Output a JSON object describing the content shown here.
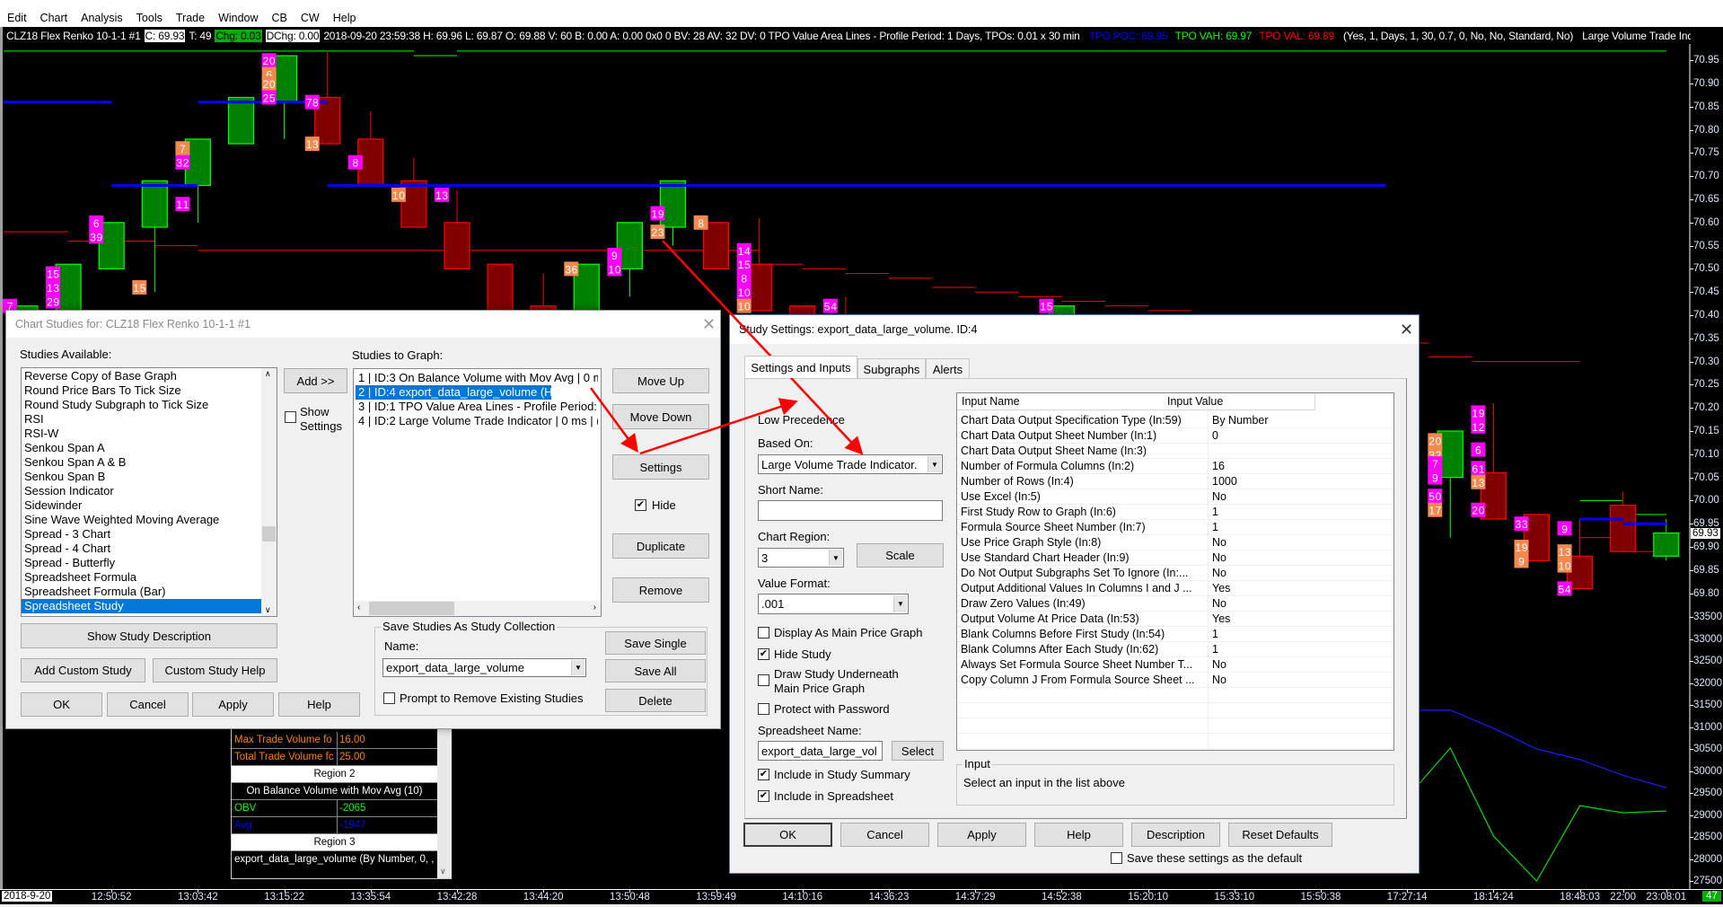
{
  "menu": [
    "Edit",
    "Chart",
    "Analysis",
    "Tools",
    "Trade",
    "Window",
    "CB",
    "CW",
    "Help"
  ],
  "status_bar": {
    "symbol": "CLZ18  Flex Renko 10-1-1  #1",
    "close": "C: 69.93",
    "ticks": "T: 49",
    "chg": "Chg: 0.03",
    "dchg": "DChg: 0.00",
    "details": "2018-09-20 23:59:38 H: 69.96 L: 69.87 O: 69.88 V: 60 B: 0.00 A: 0.00 0x0 0 BV: 28 AV: 32 DV: 0 TPO Value Area Lines - Profile Period: 1 Days, TPOs: 0.01 x 30 min",
    "poc": "TPO POC: 69.95",
    "vah": "TPO VAH: 69.97",
    "val": "TPO VAL: 69.89",
    "params": "(Yes, 1, Days, 1, 30, 0.7, 0, No, No, Standard, No)",
    "next_study": "Large Volume Trade Indicator   (6, M",
    "colors": {
      "poc": "#0000ff",
      "vah": "#00ff00",
      "val": "#ff0000",
      "chg_bg": "#00b000"
    }
  },
  "price_chart": {
    "type": "renko-candlestick",
    "price_axis": [
      "70.95",
      "70.90",
      "70.85",
      "70.80",
      "70.75",
      "70.70",
      "70.65",
      "70.60",
      "70.55",
      "70.50",
      "70.45",
      "70.40",
      "70.35",
      "70.30",
      "70.25",
      "70.20",
      "70.15",
      "70.10",
      "70.05",
      "70.00",
      "69.95",
      "69.90",
      "69.85",
      "69.80"
    ],
    "volume_axis": [
      "33500",
      "33000",
      "32500",
      "32000",
      "31500",
      "31000",
      "30500",
      "30000",
      "29500",
      "29000",
      "28500",
      "28000",
      "27500"
    ],
    "current_price": "69.93",
    "date_label": "2018-9-20",
    "bar_count": "47",
    "time_labels": [
      {
        "bar": 2,
        "t": "12:50:52"
      },
      {
        "bar": 4,
        "t": "13:03:42"
      },
      {
        "bar": 6,
        "t": "13:15:22"
      },
      {
        "bar": 8,
        "t": "13:35:54"
      },
      {
        "bar": 10,
        "t": "13:42:28"
      },
      {
        "bar": 12,
        "t": "13:44:20"
      },
      {
        "bar": 14,
        "t": "13:50:48"
      },
      {
        "bar": 16,
        "t": "13:59:49"
      },
      {
        "bar": 18,
        "t": "14:10:16"
      },
      {
        "bar": 20,
        "t": "14:36:23"
      },
      {
        "bar": 22,
        "t": "14:37:29"
      },
      {
        "bar": 24,
        "t": "14:52:38"
      },
      {
        "bar": 26,
        "t": "15:20:10"
      },
      {
        "bar": 28,
        "t": "15:33:10"
      },
      {
        "bar": 30,
        "t": "15:50:38"
      },
      {
        "bar": 32,
        "t": "17:27:14"
      },
      {
        "bar": 34,
        "t": "18:14:24"
      },
      {
        "bar": 36,
        "t": "18:48:03"
      },
      {
        "bar": 37,
        "t": "22:00"
      },
      {
        "bar": 38,
        "t": "23:08:01"
      }
    ],
    "candles": [
      {
        "bar": 0,
        "o": 70.32,
        "c": 70.42,
        "h": 70.42,
        "l": 70.32
      },
      {
        "bar": 1,
        "o": 70.41,
        "c": 70.51,
        "h": 70.51,
        "l": 70.41
      },
      {
        "bar": 2,
        "o": 70.5,
        "c": 70.6,
        "h": 70.6,
        "l": 70.5
      },
      {
        "bar": 3,
        "o": 70.59,
        "c": 70.69,
        "h": 70.69,
        "l": 70.45
      },
      {
        "bar": 4,
        "o": 70.68,
        "c": 70.78,
        "h": 70.78,
        "l": 70.6
      },
      {
        "bar": 5,
        "o": 70.77,
        "c": 70.87,
        "h": 70.87,
        "l": 70.77
      },
      {
        "bar": 6,
        "o": 70.86,
        "c": 70.96,
        "h": 70.96,
        "l": 70.78
      },
      {
        "bar": 7,
        "o": 70.87,
        "c": 70.77,
        "h": 70.97,
        "l": 70.77
      },
      {
        "bar": 8,
        "o": 70.78,
        "c": 70.68,
        "h": 70.84,
        "l": 70.68
      },
      {
        "bar": 9,
        "o": 70.69,
        "c": 70.59,
        "h": 70.74,
        "l": 70.59
      },
      {
        "bar": 10,
        "o": 70.6,
        "c": 70.5,
        "h": 70.67,
        "l": 70.5
      },
      {
        "bar": 11,
        "o": 70.51,
        "c": 70.41,
        "h": 70.51,
        "l": 70.41
      },
      {
        "bar": 12,
        "o": 70.42,
        "c": 70.32,
        "h": 70.49,
        "l": 70.32
      },
      {
        "bar": 13,
        "o": 70.41,
        "c": 70.51,
        "h": 70.51,
        "l": 70.41
      },
      {
        "bar": 14,
        "o": 70.5,
        "c": 70.6,
        "h": 70.6,
        "l": 70.44
      },
      {
        "bar": 15,
        "o": 70.59,
        "c": 70.69,
        "h": 70.69,
        "l": 70.55
      },
      {
        "bar": 16,
        "o": 70.6,
        "c": 70.5,
        "h": 70.6,
        "l": 70.5
      },
      {
        "bar": 17,
        "o": 70.51,
        "c": 70.41,
        "h": 70.61,
        "l": 70.41
      },
      {
        "bar": 18,
        "o": 70.42,
        "c": 70.32,
        "h": 70.42,
        "l": 70.32
      },
      {
        "bar": 19,
        "o": 70.32,
        "c": 70.22,
        "h": 70.44,
        "l": 70.22
      },
      {
        "bar": 24,
        "o": 70.32,
        "c": 70.42,
        "h": 70.42,
        "l": 70.32
      },
      {
        "bar": 33,
        "o": 70.05,
        "c": 70.15,
        "h": 70.15,
        "l": 69.92
      },
      {
        "bar": 34,
        "o": 70.06,
        "c": 69.96,
        "h": 70.21,
        "l": 69.96
      },
      {
        "bar": 35,
        "o": 69.97,
        "c": 69.87,
        "h": 69.97,
        "l": 69.87
      },
      {
        "bar": 36,
        "o": 69.88,
        "c": 69.81,
        "h": 69.96,
        "l": 69.81
      },
      {
        "bar": 37,
        "o": 69.99,
        "c": 69.89,
        "h": 70.02,
        "l": 69.89
      },
      {
        "bar": 38,
        "o": 69.88,
        "c": 69.93,
        "h": 69.96,
        "l": 69.87
      }
    ],
    "vah_lines": [
      {
        "from": 0,
        "to": 9.5,
        "p": 70.97
      },
      {
        "from": 9.5,
        "to": 10.5,
        "p": 70.96
      },
      {
        "from": 10.5,
        "to": 38.5,
        "p": 70.97
      },
      {
        "from": 36.5,
        "to": 37.5,
        "p": 70.0
      },
      {
        "from": 37.5,
        "to": 38.5,
        "p": 69.97
      }
    ],
    "poc_lines": [
      {
        "from": 0,
        "to": 2.5,
        "p": 70.86
      },
      {
        "from": 2.5,
        "to": 4.5,
        "p": 70.68
      },
      {
        "from": 4.5,
        "to": 7.5,
        "p": 70.86
      },
      {
        "from": 7.5,
        "to": 32,
        "p": 70.68
      },
      {
        "from": 36.5,
        "to": 37.5,
        "p": 69.96
      },
      {
        "from": 37.5,
        "to": 38.5,
        "p": 69.95
      }
    ],
    "val_lines": [
      {
        "from": 0,
        "to": 1.5,
        "p": 70.58
      },
      {
        "from": 1.5,
        "to": 3.5,
        "p": 70.56
      },
      {
        "from": 3.5,
        "to": 4.5,
        "p": 70.55
      },
      {
        "from": 4.5,
        "to": 6.5,
        "p": 70.54
      },
      {
        "from": 6.5,
        "to": 13.5,
        "p": 70.54
      },
      {
        "from": 13.5,
        "to": 17.5,
        "p": 70.54
      },
      {
        "from": 17.5,
        "to": 18.5,
        "p": 70.51
      },
      {
        "from": 18.5,
        "to": 19.5,
        "p": 70.5
      },
      {
        "from": 19.5,
        "to": 20.5,
        "p": 70.49
      },
      {
        "from": 20.5,
        "to": 21.5,
        "p": 70.48
      },
      {
        "from": 21.5,
        "to": 22.5,
        "p": 70.46
      },
      {
        "from": 22.5,
        "to": 23.5,
        "p": 70.45
      },
      {
        "from": 23.5,
        "to": 24.5,
        "p": 70.44
      },
      {
        "from": 24.5,
        "to": 25.5,
        "p": 70.43
      },
      {
        "from": 25.5,
        "to": 26.5,
        "p": 70.42
      },
      {
        "from": 26.5,
        "to": 27.5,
        "p": 70.41
      },
      {
        "from": 32,
        "to": 33,
        "p": 70.34
      },
      {
        "from": 33,
        "to": 34,
        "p": 70.31
      },
      {
        "from": 34,
        "to": 36.5,
        "p": 70.3
      },
      {
        "from": 36.5,
        "to": 37.5,
        "p": 69.92
      },
      {
        "from": 37.5,
        "to": 38.5,
        "p": 69.89
      }
    ],
    "trade_labels": [
      {
        "bar": 0,
        "p": 70.42,
        "t": "7",
        "c": "m"
      },
      {
        "bar": 1,
        "p": 70.49,
        "t": "15",
        "c": "m"
      },
      {
        "bar": 1,
        "p": 70.46,
        "t": "13",
        "c": "m"
      },
      {
        "bar": 1,
        "p": 70.43,
        "t": "29",
        "c": "m"
      },
      {
        "bar": 2,
        "p": 70.6,
        "t": "6",
        "c": "m"
      },
      {
        "bar": 2,
        "p": 70.57,
        "t": "39",
        "c": "m"
      },
      {
        "bar": 3,
        "p": 70.46,
        "t": "15",
        "c": "o"
      },
      {
        "bar": 4,
        "p": 70.76,
        "t": "7",
        "c": "o"
      },
      {
        "bar": 4,
        "p": 70.73,
        "t": "32",
        "c": "m"
      },
      {
        "bar": 4,
        "p": 70.64,
        "t": "11",
        "c": "m"
      },
      {
        "bar": 6,
        "p": 70.95,
        "t": "20",
        "c": "m"
      },
      {
        "bar": 6,
        "p": 70.92,
        "t": "6",
        "c": "o"
      },
      {
        "bar": 6,
        "p": 70.9,
        "t": "20",
        "c": "o"
      },
      {
        "bar": 6,
        "p": 70.87,
        "t": "25",
        "c": "m"
      },
      {
        "bar": 7,
        "p": 70.86,
        "t": "78",
        "c": "m"
      },
      {
        "bar": 7,
        "p": 70.77,
        "t": "13",
        "c": "o"
      },
      {
        "bar": 8,
        "p": 70.73,
        "t": "8",
        "c": "m"
      },
      {
        "bar": 9,
        "p": 70.66,
        "t": "10",
        "c": "o"
      },
      {
        "bar": 10,
        "p": 70.66,
        "t": "13",
        "c": "m"
      },
      {
        "bar": 13,
        "p": 70.5,
        "t": "36",
        "c": "o"
      },
      {
        "bar": 14,
        "p": 70.53,
        "t": "9",
        "c": "m"
      },
      {
        "bar": 14,
        "p": 70.5,
        "t": "10",
        "c": "m"
      },
      {
        "bar": 15,
        "p": 70.62,
        "t": "19",
        "c": "m"
      },
      {
        "bar": 15,
        "p": 70.58,
        "t": "23",
        "c": "o"
      },
      {
        "bar": 16,
        "p": 70.6,
        "t": "8",
        "c": "o"
      },
      {
        "bar": 17,
        "p": 70.54,
        "t": "14",
        "c": "m"
      },
      {
        "bar": 17,
        "p": 70.51,
        "t": "15",
        "c": "m"
      },
      {
        "bar": 17,
        "p": 70.48,
        "t": "8",
        "c": "m"
      },
      {
        "bar": 17,
        "p": 70.45,
        "t": "10",
        "c": "m"
      },
      {
        "bar": 17,
        "p": 70.42,
        "t": "10",
        "c": "o"
      },
      {
        "bar": 19,
        "p": 70.42,
        "t": "54",
        "c": "m"
      },
      {
        "bar": 24,
        "p": 70.42,
        "t": "15",
        "c": "m"
      },
      {
        "bar": 33,
        "p": 70.13,
        "t": "20",
        "c": "o"
      },
      {
        "bar": 33,
        "p": 70.1,
        "t": "32",
        "c": "o"
      },
      {
        "bar": 33,
        "p": 70.08,
        "t": "7",
        "c": "m"
      },
      {
        "bar": 33,
        "p": 70.05,
        "t": "9",
        "c": "m"
      },
      {
        "bar": 33,
        "p": 70.01,
        "t": "50",
        "c": "m"
      },
      {
        "bar": 33,
        "p": 69.98,
        "t": "17",
        "c": "o"
      },
      {
        "bar": 34,
        "p": 70.19,
        "t": "19",
        "c": "m"
      },
      {
        "bar": 34,
        "p": 70.16,
        "t": "12",
        "c": "m"
      },
      {
        "bar": 34,
        "p": 70.11,
        "t": "6",
        "c": "m"
      },
      {
        "bar": 34,
        "p": 70.07,
        "t": "61",
        "c": "m"
      },
      {
        "bar": 34,
        "p": 70.04,
        "t": "13",
        "c": "o"
      },
      {
        "bar": 34,
        "p": 69.98,
        "t": "20",
        "c": "m"
      },
      {
        "bar": 35,
        "p": 69.95,
        "t": "33",
        "c": "m"
      },
      {
        "bar": 35,
        "p": 69.9,
        "t": "19",
        "c": "o"
      },
      {
        "bar": 35,
        "p": 69.87,
        "t": "9",
        "c": "o"
      },
      {
        "bar": 36,
        "p": 69.94,
        "t": "9",
        "c": "m"
      },
      {
        "bar": 36,
        "p": 69.89,
        "t": "13",
        "c": "o"
      },
      {
        "bar": 36,
        "p": 69.86,
        "t": "10",
        "c": "o"
      },
      {
        "bar": 36,
        "p": 69.81,
        "t": "54",
        "c": "m"
      }
    ],
    "obv": {
      "bars": [
        32,
        33,
        34,
        35,
        36,
        37,
        38
      ],
      "obv": [
        29400,
        30520,
        28520,
        27500,
        29210,
        29050,
        29090
      ],
      "avg": [
        31380,
        31380,
        30970,
        30500,
        30260,
        29900,
        29620
      ]
    },
    "colors": {
      "up_fill": "#008000",
      "up_line": "#00ff00",
      "down_fill": "#800000",
      "down_line": "#ff0000",
      "vah": "#00ff00",
      "poc": "#0000ff",
      "val": "#ff0000",
      "label_m": "#ff00ff",
      "label_o": "#f28a50",
      "obv": "#00e000",
      "avg": "#1a1aff"
    }
  },
  "data_window": {
    "rows": [
      {
        "k": "Max Trade Volume fo",
        "v": "16.00",
        "color": "#ff8000"
      },
      {
        "k": "Total Trade Volume fc",
        "v": "25.00",
        "color": "#ff8000"
      }
    ],
    "region2": "Region 2",
    "obv_title": "On Balance Volume with Mov Avg (10)",
    "obv_rows": [
      {
        "k": "OBV",
        "v": "-2065",
        "color": "#00ff00"
      },
      {
        "k": "Avg",
        "v": "-1947",
        "color": "#0000ff"
      }
    ],
    "region3": "Region 3",
    "export_row": "export_data_large_volume (By Number, 0, ,"
  },
  "chart_studies": {
    "title": "Chart Studies for: CLZ18  Flex Renko 10-1-1  #1",
    "available_label": "Studies Available:",
    "available": [
      "Reverse Copy of Base Graph",
      "Round Price Bars To Tick Size",
      "Round Study Subgraph to Tick Size",
      "RSI",
      "RSI-W",
      "Senkou Span A",
      "Senkou Span A & B",
      "Senkou Span B",
      "Session Indicator",
      "Sidewinder",
      "Sine Wave Weighted Moving Average",
      "Spread - 3 Chart",
      "Spread - 4 Chart",
      "Spread - Butterfly",
      "Spreadsheet Formula",
      "Spreadsheet Formula (Bar)",
      "Spreadsheet Study"
    ],
    "available_selected": "Spreadsheet Study",
    "add": "Add >>",
    "show_settings_1": "Show",
    "show_settings_2": "Settings",
    "show_settings_checked": false,
    "graph_label": "Studies to Graph:",
    "graph": [
      "1 | ID:3  On Balance Volume with Mov Avg | 0 m",
      "2 | ID:4  export_data_large_volume (Hidden) | ",
      "3 | ID:1  TPO Value Area Lines - Profile Period:",
      "4 | ID:2  Large Volume Trade Indicator | 0 ms | ("
    ],
    "graph_selected_index": 1,
    "move_up": "Move Up",
    "move_down": "Move Down",
    "settings": "Settings",
    "hide": "Hide",
    "hide_checked": true,
    "duplicate": "Duplicate",
    "remove": "Remove",
    "show_desc": "Show Study Description",
    "add_custom": "Add Custom Study",
    "custom_help": "Custom Study Help",
    "ok": "OK",
    "cancel": "Cancel",
    "apply": "Apply",
    "help": "Help",
    "collection_group": "Save Studies As Study Collection",
    "name_label": "Name:",
    "name_value": "export_data_large_volume",
    "prompt_remove": "Prompt to Remove Existing Studies",
    "prompt_checked": false,
    "save_single": "Save Single",
    "save_all": "Save All",
    "delete": "Delete"
  },
  "study_settings": {
    "title": "Study Settings: export_data_large_volume. ID:4",
    "tabs": [
      "Settings and Inputs",
      "Subgraphs",
      "Alerts"
    ],
    "active_tab": "Settings and Inputs",
    "low_precedence": "Low Precedence",
    "based_on_label": "Based On:",
    "based_on": "Large Volume Trade Indicator.",
    "short_name_label": "Short Name:",
    "short_name": "",
    "chart_region_label": "Chart Region:",
    "chart_region": "3",
    "scale": "Scale",
    "value_format_label": "Value Format:",
    "value_format": ".001",
    "checks": [
      {
        "label": "Display As Main Price Graph",
        "checked": false
      },
      {
        "label": "Hide Study",
        "checked": true
      },
      {
        "label": "Draw Study Underneath",
        "label2": "Main Price Graph",
        "checked": false
      },
      {
        "label": "Protect with Password",
        "checked": false
      }
    ],
    "spreadsheet_label": "Spreadsheet Name:",
    "spreadsheet_name": "export_data_large_vol",
    "select": "Select",
    "include_summary": "Include in Study Summary",
    "include_spreadsheet": "Include in Spreadsheet",
    "include_summary_checked": true,
    "include_spreadsheet_checked": true,
    "col_name": "Input Name",
    "col_value": "Input Value",
    "inputs": [
      [
        "Chart Data Output Specification Type   (In:59)",
        "By Number"
      ],
      [
        "Chart Data Output Sheet Number   (In:1)",
        "0"
      ],
      [
        "Chart Data Output Sheet Name   (In:3)",
        ""
      ],
      [
        "Number of Formula Columns   (In:2)",
        "16"
      ],
      [
        "Number of Rows   (In:4)",
        "1000"
      ],
      [
        "Use Excel   (In:5)",
        "No"
      ],
      [
        "First Study Row to Graph   (In:6)",
        "1"
      ],
      [
        "Formula Source Sheet Number   (In:7)",
        "1"
      ],
      [
        "Use Price Graph Style   (In:8)",
        "No"
      ],
      [
        "Use Standard Chart Header   (In:9)",
        "No"
      ],
      [
        "Do Not Output Subgraphs Set To Ignore   (In:...",
        "No"
      ],
      [
        "Output Additional Values In Columns I and J   ...",
        "Yes"
      ],
      [
        "Draw Zero Values   (In:49)",
        "No"
      ],
      [
        "Output Volume At Price Data   (In:53)",
        "Yes"
      ],
      [
        "Blank Columns Before First Study   (In:54)",
        "1"
      ],
      [
        "Blank Columns After Each Study   (In:62)",
        "1"
      ],
      [
        "Always Set Formula Source Sheet Number T...",
        "No"
      ],
      [
        "Copy Column J From Formula Source Sheet ...",
        "No"
      ]
    ],
    "input_group": "Input",
    "input_hint": "Select an input in the list above",
    "buttons": [
      "OK",
      "Cancel",
      "Apply",
      "Help",
      "Description",
      "Reset Defaults"
    ],
    "save_default": "Save these settings as the default",
    "save_default_checked": false
  }
}
